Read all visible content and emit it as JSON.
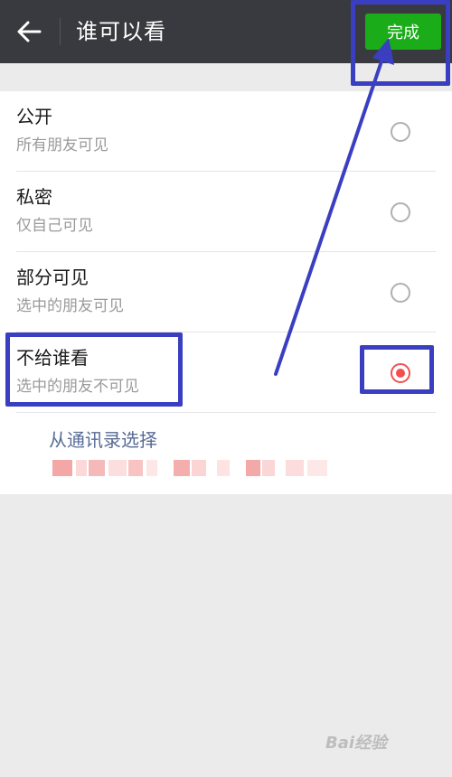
{
  "header": {
    "title": "谁可以看",
    "done_label": "完成"
  },
  "options": [
    {
      "title": "公开",
      "desc": "所有朋友可见",
      "selected": false
    },
    {
      "title": "私密",
      "desc": "仅自己可见",
      "selected": false
    },
    {
      "title": "部分可见",
      "desc": "选中的朋友可见",
      "selected": false
    },
    {
      "title": "不给谁看",
      "desc": "选中的朋友不可见",
      "selected": true
    }
  ],
  "contacts_link": "从通讯录选择",
  "watermark": "Bai经验",
  "colors": {
    "header_bg": "#393a3f",
    "done_bg": "#1aad19",
    "radio_selected": "#f25050",
    "link": "#576b95",
    "annotation": "#3a3fc2"
  }
}
